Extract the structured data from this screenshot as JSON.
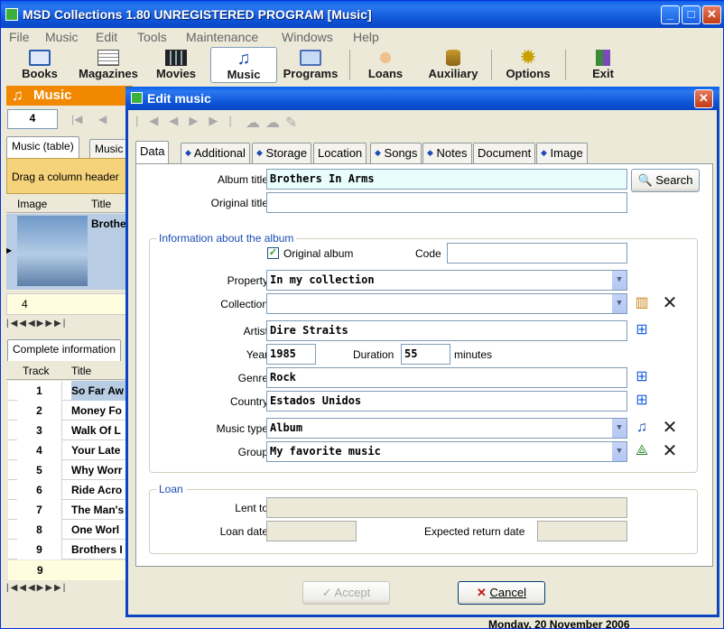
{
  "app": {
    "title": "MSD Collections 1.80 UNREGISTERED PROGRAM [Music]"
  },
  "menu": [
    "File",
    "Music",
    "Edit",
    "Tools",
    "Maintenance",
    "Windows",
    "Help"
  ],
  "toolbar": {
    "books": "Books",
    "magazines": "Magazines",
    "movies": "Movies",
    "music": "Music",
    "programs": "Programs",
    "loans": "Loans",
    "auxiliary": "Auxiliary",
    "options": "Options",
    "exit": "Exit"
  },
  "bg": {
    "module_title": "Music",
    "record_no": "4",
    "tabs": [
      "Music (table)",
      "Music"
    ],
    "group_hint": "Drag a column header",
    "col_image": "Image",
    "col_title": "Title",
    "title_cell": "Brothe",
    "row_counter": "4",
    "complete_tab": "Complete information",
    "col_track": "Track",
    "col_track_title": "Title",
    "tracks": [
      {
        "n": "1",
        "t": "So Far Aw"
      },
      {
        "n": "2",
        "t": "Money Fo"
      },
      {
        "n": "3",
        "t": "Walk Of L"
      },
      {
        "n": "4",
        "t": "Your Late"
      },
      {
        "n": "5",
        "t": "Why Worr"
      },
      {
        "n": "6",
        "t": "Ride Acro"
      },
      {
        "n": "7",
        "t": "The Man's"
      },
      {
        "n": "8",
        "t": "One Worl"
      },
      {
        "n": "9",
        "t": "Brothers I"
      }
    ],
    "track_count": "9",
    "status": "Monday, 20 November 2006"
  },
  "dialog": {
    "title": "Edit music",
    "tabs": [
      "Data",
      "Additional",
      "Storage",
      "Location",
      "Songs",
      "Notes",
      "Document",
      "Image"
    ],
    "album_title_label": "Album title",
    "album_title": "Brothers In Arms",
    "search": "Search",
    "original_title_label": "Original title",
    "original_title": "",
    "info_group": "Information about the album",
    "original_album_label": "Original album",
    "code_label": "Code",
    "code": "",
    "property_label": "Property",
    "property": "In my collection",
    "collection_label": "Collection",
    "collection": "",
    "artist_label": "Artist",
    "artist": "Dire Straits",
    "year_label": "Year",
    "year": "1985",
    "duration_label": "Duration",
    "duration": "55",
    "minutes": "minutes",
    "genre_label": "Genre",
    "genre": "Rock",
    "country_label": "Country",
    "country": "Estados Unidos",
    "music_type_label": "Music type",
    "music_type": "Album",
    "group_label": "Group",
    "group": "My favorite music",
    "loan_group": "Loan",
    "lent_to_label": "Lent to",
    "lent_to": "",
    "loan_date_label": "Loan date",
    "loan_date": "",
    "expected_return_label": "Expected return date",
    "expected_return": "",
    "accept": "Accept",
    "cancel": "Cancel"
  }
}
